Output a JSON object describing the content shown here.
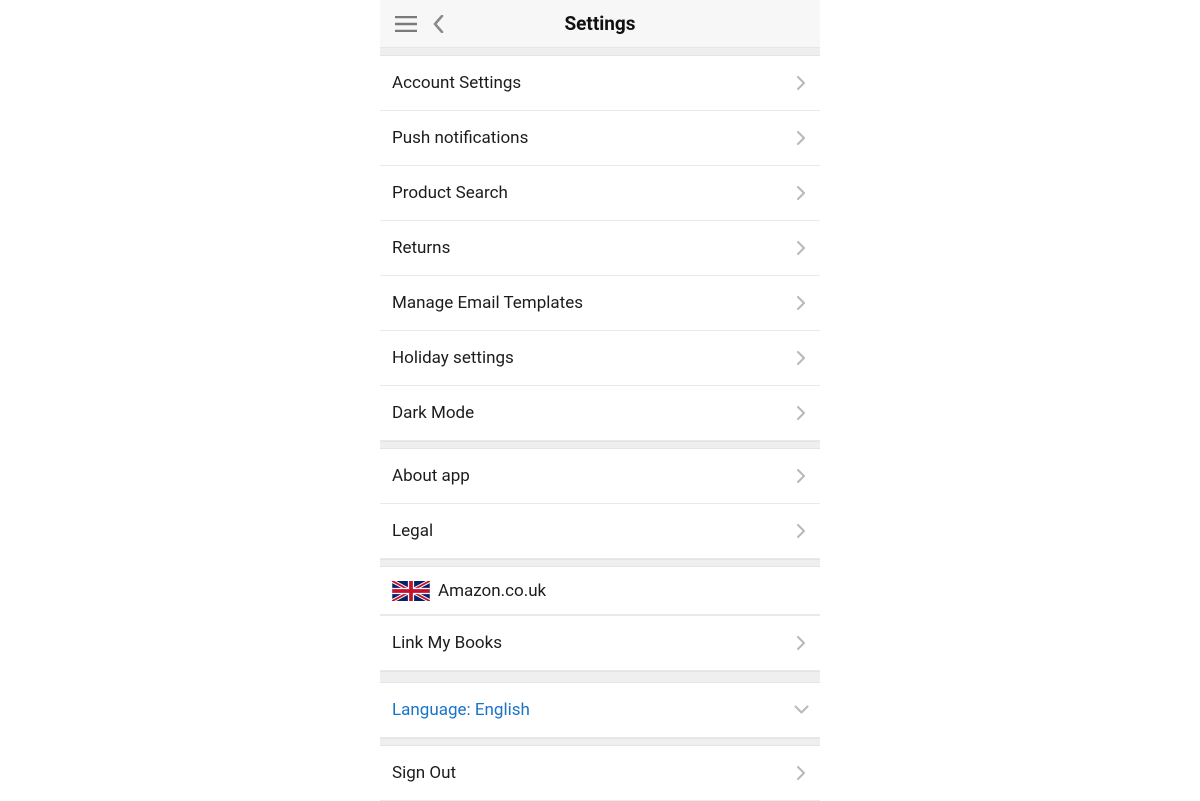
{
  "header": {
    "title": "Settings"
  },
  "groups": {
    "g1": [
      {
        "label": "Account Settings"
      },
      {
        "label": "Push notifications"
      },
      {
        "label": "Product Search"
      },
      {
        "label": "Returns"
      },
      {
        "label": "Manage Email Templates"
      },
      {
        "label": "Holiday settings"
      },
      {
        "label": "Dark Mode"
      }
    ],
    "g2": [
      {
        "label": "About app"
      },
      {
        "label": "Legal"
      }
    ],
    "g3": [
      {
        "label": "Amazon.co.uk",
        "flag": "uk",
        "no_chevron": true
      }
    ],
    "g4": [
      {
        "label": "Link My Books"
      }
    ],
    "g5": [
      {
        "label": "Language: English",
        "accent": true,
        "chevron": "down"
      }
    ],
    "g6": [
      {
        "label": "Sign Out"
      }
    ]
  }
}
